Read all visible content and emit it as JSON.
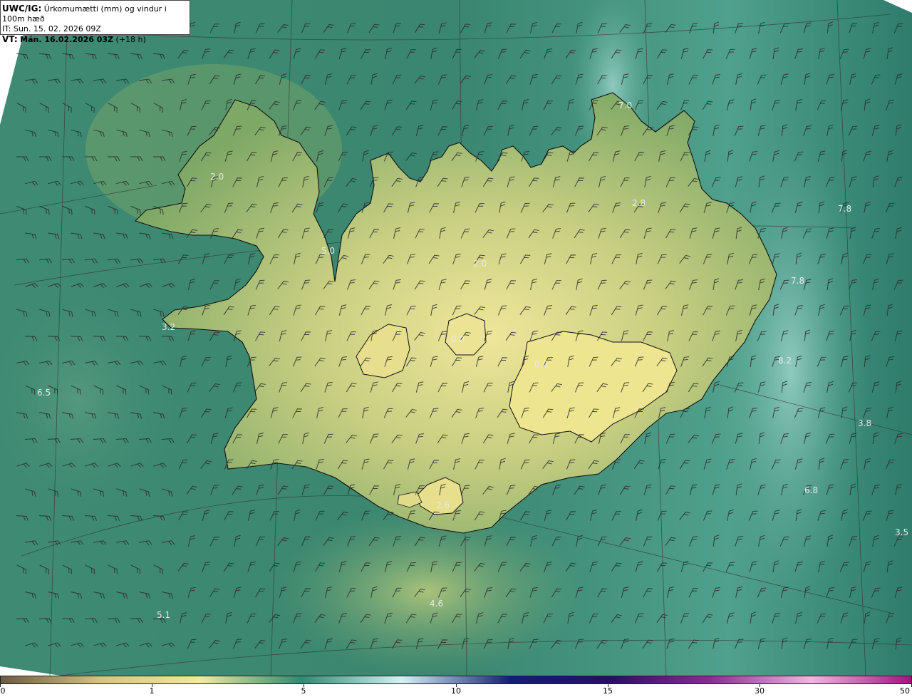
{
  "header": {
    "line1_prefix": "UWC/IG:",
    "line1_text": "Úrkomumætti (mm) og vindur i 100m hæð",
    "line2": "IT: Sun. 15. 02. 2026 09Z",
    "line3_prefix": "VT:",
    "line3_value": "Mán. 16.02.2026 03Z",
    "line3_suffix": "(+18 h)"
  },
  "colorbar": {
    "labels": [
      "0",
      "1",
      "5",
      "10",
      "15",
      "30",
      "50"
    ],
    "colors": [
      "#6b5a44",
      "#d8c47a",
      "#f2ea9a",
      "#2e8a72",
      "#d4f2f4",
      "#141c7a",
      "#2a0c6a",
      "#8b2a9a",
      "#f2b6e0",
      "#a01284"
    ]
  },
  "map_labels": [
    {
      "text": "7.0"
    },
    {
      "text": "2.8"
    },
    {
      "text": "7.8"
    },
    {
      "text": "7.8"
    },
    {
      "text": "2.0"
    },
    {
      "text": "5.0"
    },
    {
      "text": "2.0"
    },
    {
      "text": "3.2"
    },
    {
      "text": "0.0"
    },
    {
      "text": "6.5"
    },
    {
      "text": "8.2"
    },
    {
      "text": "3.8"
    },
    {
      "text": "6.8"
    },
    {
      "text": "3.5"
    },
    {
      "text": "4.6"
    },
    {
      "text": "5.1"
    },
    {
      "text": "0.0"
    },
    {
      "text": "2.6"
    }
  ],
  "colors": {
    "ocean": "#2f7f6e",
    "ocean_light": "#5fa88e",
    "land": "#8fb06a",
    "land_high": "#e8e08a",
    "coast": "#111111",
    "grid": "#333333",
    "barb": "#2b2b2b"
  }
}
